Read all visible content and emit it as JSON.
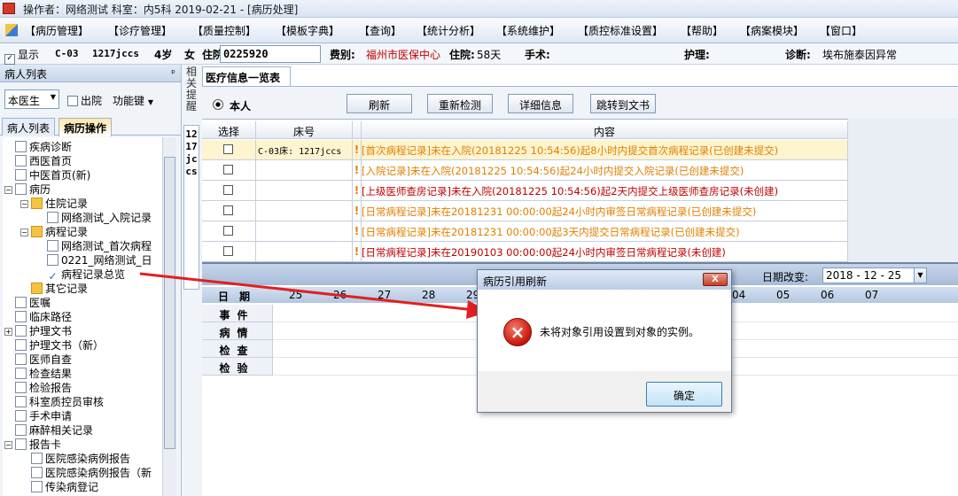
{
  "titlebar": {
    "text": "操作者：网络测试  科室：内5科  2019-02-21 - [病历处理]"
  },
  "menu": [
    "【病历管理】",
    "【诊疗管理】",
    "【质量控制】",
    "【模板字典】",
    "【查询】",
    "【统计分析】",
    "【系统维护】",
    "【质控标准设置】",
    "【帮助】",
    "【病案模块】",
    "【窗口】"
  ],
  "patient": {
    "show_label": "显示",
    "bed": "C-03",
    "id": "1217jccs",
    "age": "4岁",
    "sex": "女",
    "admit_label": "住院号:",
    "admit_no": "0225920",
    "fee_label": "费别:",
    "fee_value": "福州市医保中心",
    "stay_label": "住院:",
    "stay_value": "58天",
    "surgery_label": "手术:",
    "nursing_label": "护理:",
    "diagnosis_label": "诊断:",
    "diagnosis_value": "埃布施泰因异常"
  },
  "left": {
    "header": "病人列表",
    "pin": "ᵖ",
    "doctor_select": "本医生",
    "discharged_label": "出院",
    "function_key": "功能键",
    "tabs": [
      "病人列表",
      "病历操作"
    ],
    "tree": [
      {
        "label": "疾病诊断",
        "indent": 0,
        "icon": "doc"
      },
      {
        "label": "西医首页",
        "indent": 0,
        "icon": "doc"
      },
      {
        "label": "中医首页(新)",
        "indent": 0,
        "icon": "doc"
      },
      {
        "label": "病历",
        "indent": 0,
        "icon": "doc",
        "exp": "−"
      },
      {
        "label": "住院记录",
        "indent": 1,
        "icon": "folder",
        "exp": "−"
      },
      {
        "label": "网络测试_入院记录",
        "indent": 2,
        "icon": "doc"
      },
      {
        "label": "病程记录",
        "indent": 1,
        "icon": "folder",
        "exp": "−"
      },
      {
        "label": "网络测试_首次病程",
        "indent": 2,
        "icon": "doc"
      },
      {
        "label": "0221_网络测试_日",
        "indent": 2,
        "icon": "doc"
      },
      {
        "label": "病程记录总览",
        "indent": 2,
        "icon": "check"
      },
      {
        "label": "其它记录",
        "indent": 1,
        "icon": "folder"
      },
      {
        "label": "医嘱",
        "indent": 0,
        "icon": "doc"
      },
      {
        "label": "临床路径",
        "indent": 0,
        "icon": "doc"
      },
      {
        "label": "护理文书",
        "indent": 0,
        "icon": "doc",
        "exp": "+"
      },
      {
        "label": "护理文书（新）",
        "indent": 0,
        "icon": "doc"
      },
      {
        "label": "医师自查",
        "indent": 0,
        "icon": "doc"
      },
      {
        "label": "检查结果",
        "indent": 0,
        "icon": "doc"
      },
      {
        "label": "检验报告",
        "indent": 0,
        "icon": "doc"
      },
      {
        "label": "科室质控员审核",
        "indent": 0,
        "icon": "doc"
      },
      {
        "label": "手术申请",
        "indent": 0,
        "icon": "doc"
      },
      {
        "label": "麻醉相关记录",
        "indent": 0,
        "icon": "doc"
      },
      {
        "label": "报告卡",
        "indent": 0,
        "icon": "doc",
        "exp": "−"
      },
      {
        "label": "医院感染病例报告",
        "indent": 1,
        "icon": "doc"
      },
      {
        "label": "医院感染病例报告（新",
        "indent": 1,
        "icon": "doc"
      },
      {
        "label": "传染病登记",
        "indent": 1,
        "icon": "doc"
      }
    ]
  },
  "side": {
    "tab1": "相关提醒",
    "tab2": "1217jccs"
  },
  "main": {
    "tab": "医疗信息一览表",
    "radio_label": "本人",
    "buttons": [
      "刷新",
      "重新检测",
      "详细信息",
      "跳转到文书"
    ],
    "grid_headers": [
      "选择",
      "床号",
      "内容"
    ],
    "rows": [
      {
        "bed": "C-03床: 1217jccs",
        "content": "[首次病程记录]未在入院(20181225  10:54:56)起8小时内提交首次病程记录(已创建未提交)",
        "color": "#e08000"
      },
      {
        "bed": "",
        "content": "[入院记录]未在入院(20181225  10:54:56)起24小时内提交入院记录(已创建未提交)",
        "color": "#e08000"
      },
      {
        "bed": "",
        "content": "[上级医师查房记录]未在入院(20181225  10:54:56)起2天内提交上级医师查房记录(未创建)",
        "color": "#c00000"
      },
      {
        "bed": "",
        "content": "[日常病程记录]未在20181231  00:00:00起24小时内审签日常病程记录(已创建未提交)",
        "color": "#e08000"
      },
      {
        "bed": "",
        "content": "[日常病程记录]未在20181231  00:00:00起3天内提交日常病程记录(已创建未提交)",
        "color": "#e08000"
      },
      {
        "bed": "",
        "content": "[日常病程记录]未在20190103  00:00:00起24小时内审签日常病程记录(未创建)",
        "color": "#c00000"
      }
    ],
    "excl": "!"
  },
  "calendar": {
    "date_label": "日期改变:",
    "date_value": "2018 - 12 - 25",
    "row_labels": [
      "日期",
      "事件",
      "病情",
      "检查",
      "检验"
    ],
    "days": [
      "25",
      "26",
      "27",
      "28",
      "29",
      "04",
      "05",
      "06",
      "07"
    ]
  },
  "dialog": {
    "title": "病历引用刷新",
    "close": "X",
    "icon": "×",
    "message": "未将对象引用设置到对象的实例。",
    "ok": "确定"
  }
}
